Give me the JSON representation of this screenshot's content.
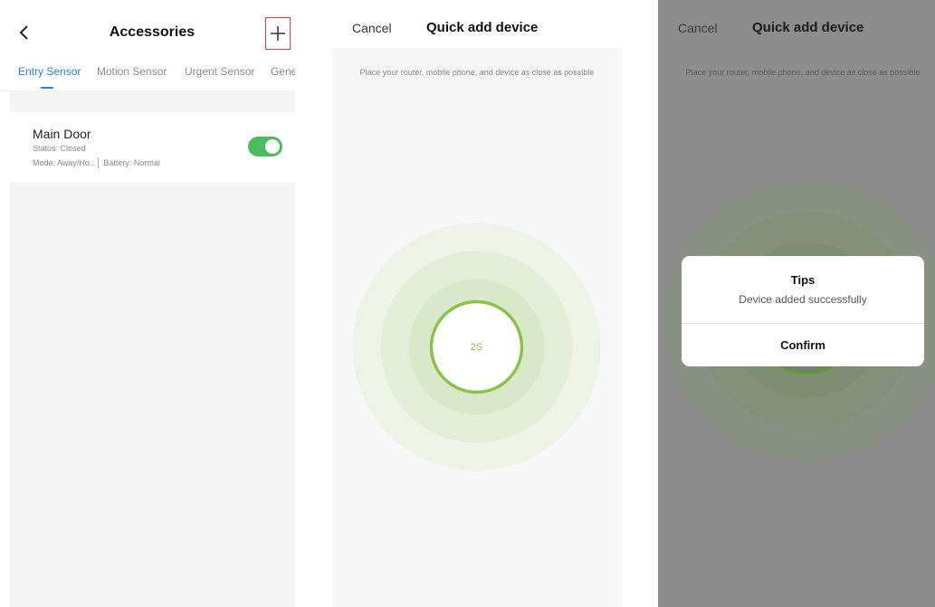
{
  "accessories": {
    "title": "Accessories",
    "back_icon": "chevron-left-icon",
    "add_icon": "plus-icon",
    "tabs": [
      {
        "label": "Entry Sensor",
        "active": true
      },
      {
        "label": "Motion Sensor",
        "active": false
      },
      {
        "label": "Urgent Sensor",
        "active": false
      },
      {
        "label": "Gene",
        "active": false
      }
    ],
    "device": {
      "name": "Main Door",
      "status": "Status: Closed",
      "mode": "Mode: Away/Ho...",
      "battery": "Battery: Normal",
      "enabled": true
    },
    "colors": {
      "accent": "#2b7fd6",
      "toggle": "#4cbb5f",
      "highlight": "#e53935"
    }
  },
  "quick_add": {
    "cancel_label": "Cancel",
    "title": "Quick add device",
    "hint": "Place your router, mobile phone, and device as close as possible",
    "countdown": "2S",
    "colors": {
      "ring": "#8bc34a",
      "countdown_text": "#8bc34a"
    }
  },
  "quick_add_done": {
    "cancel_label": "Cancel",
    "title": "Quick add device",
    "hint": "Place your router, mobile phone, and device as close as possible",
    "dialog": {
      "title": "Tips",
      "message": "Device added successfully",
      "confirm_label": "Confirm"
    }
  }
}
